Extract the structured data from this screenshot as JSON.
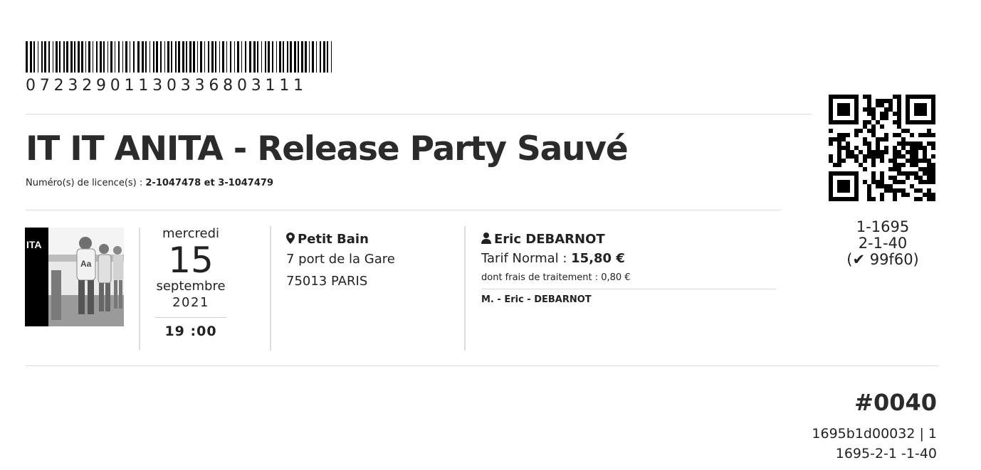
{
  "barcode": {
    "number": "07232901130336803111"
  },
  "event": {
    "title": "IT IT ANITA - Release Party Sauvé",
    "licence_label": "Numéro(s) de licence(s) : ",
    "licence_value": "2-1047478 et 3-1047479"
  },
  "qr": {
    "line1": "1-1695",
    "line2": "2-1-40",
    "check_code": "(✔ 99f60)"
  },
  "cover": {
    "label": "ITA"
  },
  "date": {
    "weekday": "mercredi",
    "day": "15",
    "month": "septembre",
    "year": "2021",
    "time": "19 :00"
  },
  "venue": {
    "icon": "map-pin-icon",
    "name": "Petit Bain",
    "address1": "7 port de la Gare",
    "address2": "75013 PARIS"
  },
  "holder": {
    "icon": "user-icon",
    "name": "Eric DEBARNOT",
    "tarif_label": "Tarif Normal : ",
    "tarif_value": "15,80 €",
    "fees": "dont frais de traitement : 0,80 €",
    "attendee": "M. - Eric - DEBARNOT"
  },
  "ticket": {
    "number": "#0040",
    "ref1": "1695b1d00032 | 1",
    "ref2": "1695-2-1 -1-40"
  }
}
